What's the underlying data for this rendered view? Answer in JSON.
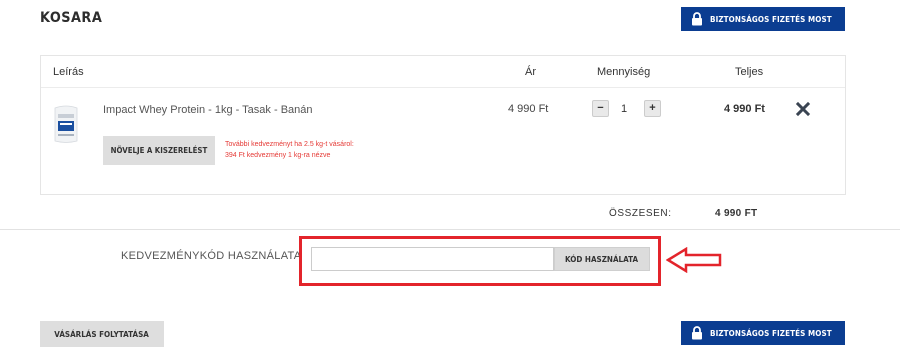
{
  "page": {
    "title": "KOSARA"
  },
  "secure_checkout": {
    "label": "BIZTONSÁGOS FIZETÉS MOST"
  },
  "table": {
    "headers": {
      "description": "Leírás",
      "price": "Ár",
      "quantity": "Mennyiség",
      "total": "Teljes"
    }
  },
  "item": {
    "name": "Impact Whey Protein - 1kg - Tasak - Banán",
    "price": "4 990 Ft",
    "quantity": "1",
    "total": "4 990 Ft",
    "qty_minus": "−",
    "qty_plus": "+",
    "upsize_label": "NÖVELJE A KISZERELÉST",
    "promo_line1": "További kedvezményt ha 2.5 kg-t vásárol:",
    "promo_line2": "394 Ft kedvezmény 1 kg-ra nézve"
  },
  "summary": {
    "label": "ÖSSZESEN:",
    "value": "4 990 FT"
  },
  "coupon": {
    "label": "KEDVEZMÉNYKÓD HASZNÁLATA",
    "placeholder": "",
    "value": "",
    "button_label": "KÓD HASZNÁLATA"
  },
  "footer": {
    "continue_label": "VÁSÁRLÁS FOLYTATÁSA"
  },
  "colors": {
    "primary": "#0b3d91",
    "highlight": "#e3242b",
    "promo_text": "#e53935"
  }
}
